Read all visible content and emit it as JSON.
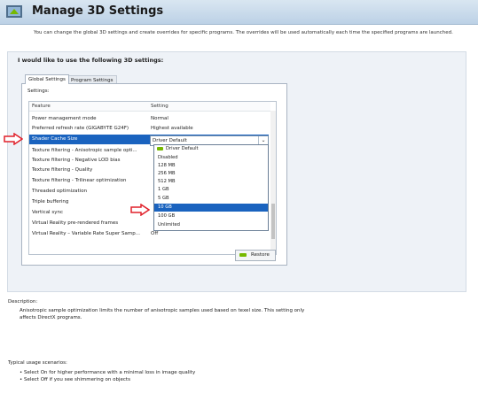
{
  "page": {
    "title": "Manage 3D Settings",
    "subtitle": "You can change the global 3D settings and create overrides for specific programs. The overrides will be used automatically each time the specified programs are launched."
  },
  "section": {
    "heading": "I would like to use the following 3D settings:"
  },
  "tabs": [
    {
      "label": "Global Settings",
      "active": true
    },
    {
      "label": "Program Settings",
      "active": false
    }
  ],
  "settings_label": "Settings:",
  "grid": {
    "columns": [
      "Feature",
      "Setting"
    ],
    "rows": [
      {
        "feature": "Power management mode",
        "setting": "Normal"
      },
      {
        "feature": "Preferred refresh rate (GIGABYTE G24F)",
        "setting": "Highest available"
      },
      {
        "feature": "Shader Cache Size",
        "setting": "Driver Default",
        "selected": true
      },
      {
        "feature": "Texture filtering - Anisotropic sample opti...",
        "setting": ""
      },
      {
        "feature": "Texture filtering - Negative LOD bias",
        "setting": ""
      },
      {
        "feature": "Texture filtering - Quality",
        "setting": ""
      },
      {
        "feature": "Texture filtering - Trilinear optimization",
        "setting": ""
      },
      {
        "feature": "Threaded optimization",
        "setting": ""
      },
      {
        "feature": "Triple buffering",
        "setting": ""
      },
      {
        "feature": "Vertical sync",
        "setting": ""
      },
      {
        "feature": "Virtual Reality pre-rendered frames",
        "setting": ""
      },
      {
        "feature": "Virtual Reality – Variable Rate Super Samp...",
        "setting": "Off"
      }
    ]
  },
  "combo": {
    "value": "Driver Default"
  },
  "dropdown": {
    "options": [
      "Driver Default",
      "Disabled",
      "128 MB",
      "256 MB",
      "512 MB",
      "1 GB",
      "5 GB",
      "10 GB",
      "100 GB",
      "Unlimited"
    ],
    "highlighted": "10 GB"
  },
  "restore_button": {
    "label": "Restore"
  },
  "description": {
    "label": "Description:",
    "text": "Anisotropic sample optimization limits the number of anisotropic samples used based on texel size. This setting only affects DirectX programs."
  },
  "usage": {
    "label": "Typical usage scenarios:",
    "items": [
      "• Select On for higher performance with a minimal loss in image quality",
      "• Select Off if you see shimmering on objects"
    ]
  },
  "colors": {
    "selection": "#1a63bf",
    "nvidia_green": "#76b900",
    "annotation_arrow": "#e0202a"
  }
}
